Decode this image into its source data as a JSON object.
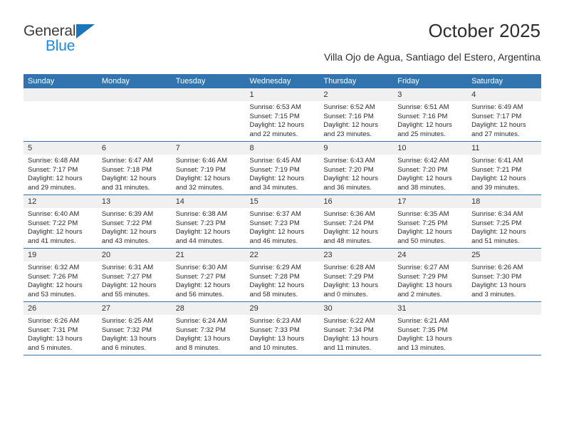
{
  "logo": {
    "word_one": "General",
    "word_two": "Blue",
    "triangle_color": "#1b75bb",
    "blue_text_color": "#1b8ae0"
  },
  "header": {
    "title": "October 2025",
    "subtitle": "Villa Ojo de Agua, Santiago del Estero, Argentina",
    "header_bg_color": "#3174b0",
    "header_text_color": "#ffffff",
    "daynum_bg_color": "#f0f0f0"
  },
  "weekdays": [
    "Sunday",
    "Monday",
    "Tuesday",
    "Wednesday",
    "Thursday",
    "Friday",
    "Saturday"
  ],
  "labels": {
    "sunrise": "Sunrise:",
    "sunset": "Sunset:",
    "daylight": "Daylight:"
  },
  "weeks": [
    [
      {
        "day": "",
        "lines": []
      },
      {
        "day": "",
        "lines": []
      },
      {
        "day": "",
        "lines": []
      },
      {
        "day": "1",
        "lines": [
          "Sunrise: 6:53 AM",
          "Sunset: 7:15 PM",
          "Daylight: 12 hours and 22 minutes."
        ]
      },
      {
        "day": "2",
        "lines": [
          "Sunrise: 6:52 AM",
          "Sunset: 7:16 PM",
          "Daylight: 12 hours and 23 minutes."
        ]
      },
      {
        "day": "3",
        "lines": [
          "Sunrise: 6:51 AM",
          "Sunset: 7:16 PM",
          "Daylight: 12 hours and 25 minutes."
        ]
      },
      {
        "day": "4",
        "lines": [
          "Sunrise: 6:49 AM",
          "Sunset: 7:17 PM",
          "Daylight: 12 hours and 27 minutes."
        ]
      }
    ],
    [
      {
        "day": "5",
        "lines": [
          "Sunrise: 6:48 AM",
          "Sunset: 7:17 PM",
          "Daylight: 12 hours and 29 minutes."
        ]
      },
      {
        "day": "6",
        "lines": [
          "Sunrise: 6:47 AM",
          "Sunset: 7:18 PM",
          "Daylight: 12 hours and 31 minutes."
        ]
      },
      {
        "day": "7",
        "lines": [
          "Sunrise: 6:46 AM",
          "Sunset: 7:19 PM",
          "Daylight: 12 hours and 32 minutes."
        ]
      },
      {
        "day": "8",
        "lines": [
          "Sunrise: 6:45 AM",
          "Sunset: 7:19 PM",
          "Daylight: 12 hours and 34 minutes."
        ]
      },
      {
        "day": "9",
        "lines": [
          "Sunrise: 6:43 AM",
          "Sunset: 7:20 PM",
          "Daylight: 12 hours and 36 minutes."
        ]
      },
      {
        "day": "10",
        "lines": [
          "Sunrise: 6:42 AM",
          "Sunset: 7:20 PM",
          "Daylight: 12 hours and 38 minutes."
        ]
      },
      {
        "day": "11",
        "lines": [
          "Sunrise: 6:41 AM",
          "Sunset: 7:21 PM",
          "Daylight: 12 hours and 39 minutes."
        ]
      }
    ],
    [
      {
        "day": "12",
        "lines": [
          "Sunrise: 6:40 AM",
          "Sunset: 7:22 PM",
          "Daylight: 12 hours and 41 minutes."
        ]
      },
      {
        "day": "13",
        "lines": [
          "Sunrise: 6:39 AM",
          "Sunset: 7:22 PM",
          "Daylight: 12 hours and 43 minutes."
        ]
      },
      {
        "day": "14",
        "lines": [
          "Sunrise: 6:38 AM",
          "Sunset: 7:23 PM",
          "Daylight: 12 hours and 44 minutes."
        ]
      },
      {
        "day": "15",
        "lines": [
          "Sunrise: 6:37 AM",
          "Sunset: 7:23 PM",
          "Daylight: 12 hours and 46 minutes."
        ]
      },
      {
        "day": "16",
        "lines": [
          "Sunrise: 6:36 AM",
          "Sunset: 7:24 PM",
          "Daylight: 12 hours and 48 minutes."
        ]
      },
      {
        "day": "17",
        "lines": [
          "Sunrise: 6:35 AM",
          "Sunset: 7:25 PM",
          "Daylight: 12 hours and 50 minutes."
        ]
      },
      {
        "day": "18",
        "lines": [
          "Sunrise: 6:34 AM",
          "Sunset: 7:25 PM",
          "Daylight: 12 hours and 51 minutes."
        ]
      }
    ],
    [
      {
        "day": "19",
        "lines": [
          "Sunrise: 6:32 AM",
          "Sunset: 7:26 PM",
          "Daylight: 12 hours and 53 minutes."
        ]
      },
      {
        "day": "20",
        "lines": [
          "Sunrise: 6:31 AM",
          "Sunset: 7:27 PM",
          "Daylight: 12 hours and 55 minutes."
        ]
      },
      {
        "day": "21",
        "lines": [
          "Sunrise: 6:30 AM",
          "Sunset: 7:27 PM",
          "Daylight: 12 hours and 56 minutes."
        ]
      },
      {
        "day": "22",
        "lines": [
          "Sunrise: 6:29 AM",
          "Sunset: 7:28 PM",
          "Daylight: 12 hours and 58 minutes."
        ]
      },
      {
        "day": "23",
        "lines": [
          "Sunrise: 6:28 AM",
          "Sunset: 7:29 PM",
          "Daylight: 13 hours and 0 minutes."
        ]
      },
      {
        "day": "24",
        "lines": [
          "Sunrise: 6:27 AM",
          "Sunset: 7:29 PM",
          "Daylight: 13 hours and 2 minutes."
        ]
      },
      {
        "day": "25",
        "lines": [
          "Sunrise: 6:26 AM",
          "Sunset: 7:30 PM",
          "Daylight: 13 hours and 3 minutes."
        ]
      }
    ],
    [
      {
        "day": "26",
        "lines": [
          "Sunrise: 6:26 AM",
          "Sunset: 7:31 PM",
          "Daylight: 13 hours and 5 minutes."
        ]
      },
      {
        "day": "27",
        "lines": [
          "Sunrise: 6:25 AM",
          "Sunset: 7:32 PM",
          "Daylight: 13 hours and 6 minutes."
        ]
      },
      {
        "day": "28",
        "lines": [
          "Sunrise: 6:24 AM",
          "Sunset: 7:32 PM",
          "Daylight: 13 hours and 8 minutes."
        ]
      },
      {
        "day": "29",
        "lines": [
          "Sunrise: 6:23 AM",
          "Sunset: 7:33 PM",
          "Daylight: 13 hours and 10 minutes."
        ]
      },
      {
        "day": "30",
        "lines": [
          "Sunrise: 6:22 AM",
          "Sunset: 7:34 PM",
          "Daylight: 13 hours and 11 minutes."
        ]
      },
      {
        "day": "31",
        "lines": [
          "Sunrise: 6:21 AM",
          "Sunset: 7:35 PM",
          "Daylight: 13 hours and 13 minutes."
        ]
      },
      {
        "day": "",
        "lines": []
      }
    ]
  ]
}
